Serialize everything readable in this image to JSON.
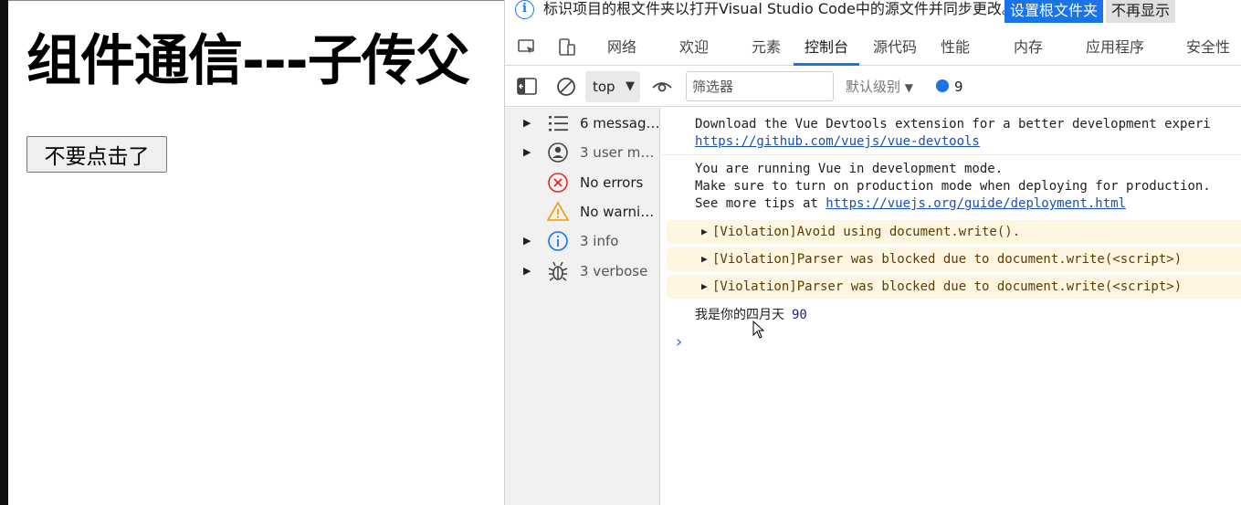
{
  "page": {
    "heading": "组件通信---子传父",
    "button_label": "不要点击了"
  },
  "infobar": {
    "message": "标识项目的根文件夹以打开Visual Studio Code中的源文件并同步更改。",
    "primary_button": "设置根文件夹",
    "secondary_button": "不再显示"
  },
  "tabs": [
    {
      "label": "网络"
    },
    {
      "label": "欢迎"
    },
    {
      "label": "元素"
    },
    {
      "label": "控制台",
      "active": true
    },
    {
      "label": "源代码"
    },
    {
      "label": "性能"
    },
    {
      "label": "内存"
    },
    {
      "label": "应用程序"
    },
    {
      "label": "安全性"
    }
  ],
  "toolbar": {
    "context": "top",
    "filter_placeholder": "筛选器",
    "levels_label": "默认级别",
    "issues_count": "9"
  },
  "sidebar": [
    {
      "label": "6 messages",
      "icon": "list-icon",
      "expandable": true
    },
    {
      "label": "3 user me...",
      "icon": "user-icon",
      "expandable": true
    },
    {
      "label": "No errors",
      "icon": "error-icon",
      "expandable": false
    },
    {
      "label": "No warnin...",
      "icon": "warning-icon",
      "expandable": false
    },
    {
      "label": "3 info",
      "icon": "info-icon",
      "expandable": true
    },
    {
      "label": "3 verbose",
      "icon": "bug-icon",
      "expandable": true
    }
  ],
  "console": {
    "devtools_line": "Download the Vue Devtools extension for a better development experi",
    "devtools_link": "https://github.com/vuejs/vue-devtools",
    "dev_mode_line1": "You are running Vue in development mode.",
    "dev_mode_line2": "Make sure to turn on production mode when deploying for production.",
    "dev_mode_line3_prefix": "See more tips at ",
    "dev_mode_link": "https://vuejs.org/guide/deployment.html",
    "violations": [
      "[Violation]Avoid using document.write().",
      "[Violation]Parser was blocked due to document.write(<script>)",
      "[Violation]Parser was blocked due to document.write(<script>)"
    ],
    "log_text": "我是你的四月天",
    "log_value": "90"
  },
  "colors": {
    "accent": "#1a73e8",
    "warning_bg": "#fef6e0",
    "error": "#d93025",
    "warning": "#f29900"
  }
}
